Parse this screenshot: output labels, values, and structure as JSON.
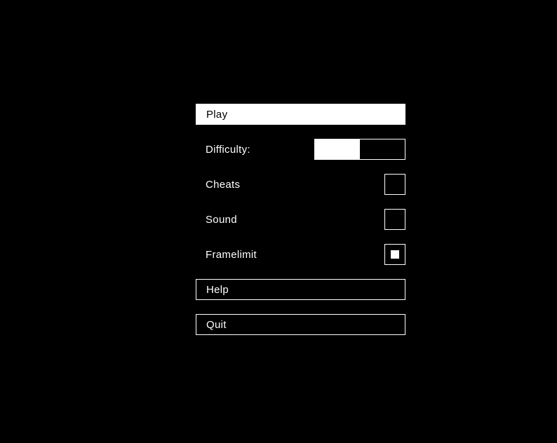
{
  "menu": {
    "play": {
      "label": "Play",
      "selected": true
    },
    "help": {
      "label": "Help"
    },
    "quit": {
      "label": "Quit"
    }
  },
  "options": {
    "difficulty": {
      "label": "Difficulty:",
      "value_percent": 50
    },
    "cheats": {
      "label": "Cheats",
      "checked": false
    },
    "sound": {
      "label": "Sound",
      "checked": false
    },
    "framelimit": {
      "label": "Framelimit",
      "checked": true
    }
  }
}
